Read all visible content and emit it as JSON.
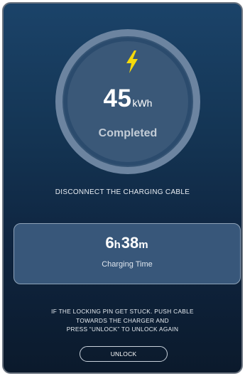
{
  "session": {
    "energy_value": "45",
    "energy_unit": "kWh",
    "status": "Completed"
  },
  "instruction": "DISCONNECT THE CHARGING CABLE",
  "charging_time": {
    "hours": "6",
    "hours_unit": "h",
    "minutes": "38",
    "minutes_unit": "m",
    "label": "Charging Time"
  },
  "help_lines": [
    "IF THE LOCKING PIN GET STUCK. PUSH CABLE",
    "TOWARDS THE CHARGER AND",
    "PRESS “UNLOCK” TO UNLOCK AGAIN"
  ],
  "unlock_button_label": "UNLOCK",
  "icons": {
    "bolt": "lightning-bolt-icon"
  },
  "colors": {
    "bolt": "#f5d90a",
    "background_top": "#1b4369",
    "background_bottom": "#0b1a2c",
    "ring": "#6c84a0"
  }
}
